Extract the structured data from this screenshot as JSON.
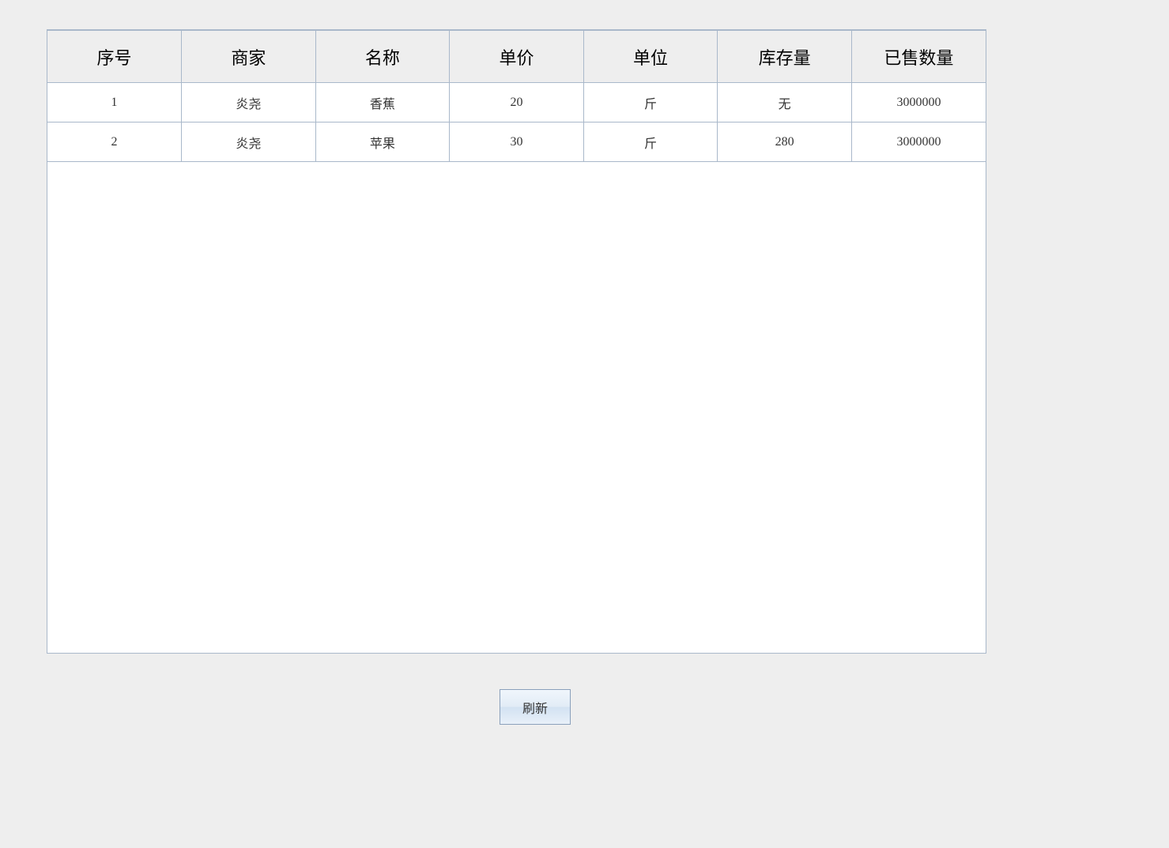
{
  "table": {
    "headers": [
      "序号",
      "商家",
      "名称",
      "单价",
      "单位",
      "库存量",
      "已售数量"
    ],
    "rows": [
      {
        "index": "1",
        "merchant": "炎尧",
        "name": "香蕉",
        "price": "20",
        "unit": "斤",
        "stock": "无",
        "sold": "3000000"
      },
      {
        "index": "2",
        "merchant": "炎尧",
        "name": "苹果",
        "price": "30",
        "unit": "斤",
        "stock": "280",
        "sold": "3000000"
      }
    ]
  },
  "buttons": {
    "refresh": "刷新"
  }
}
